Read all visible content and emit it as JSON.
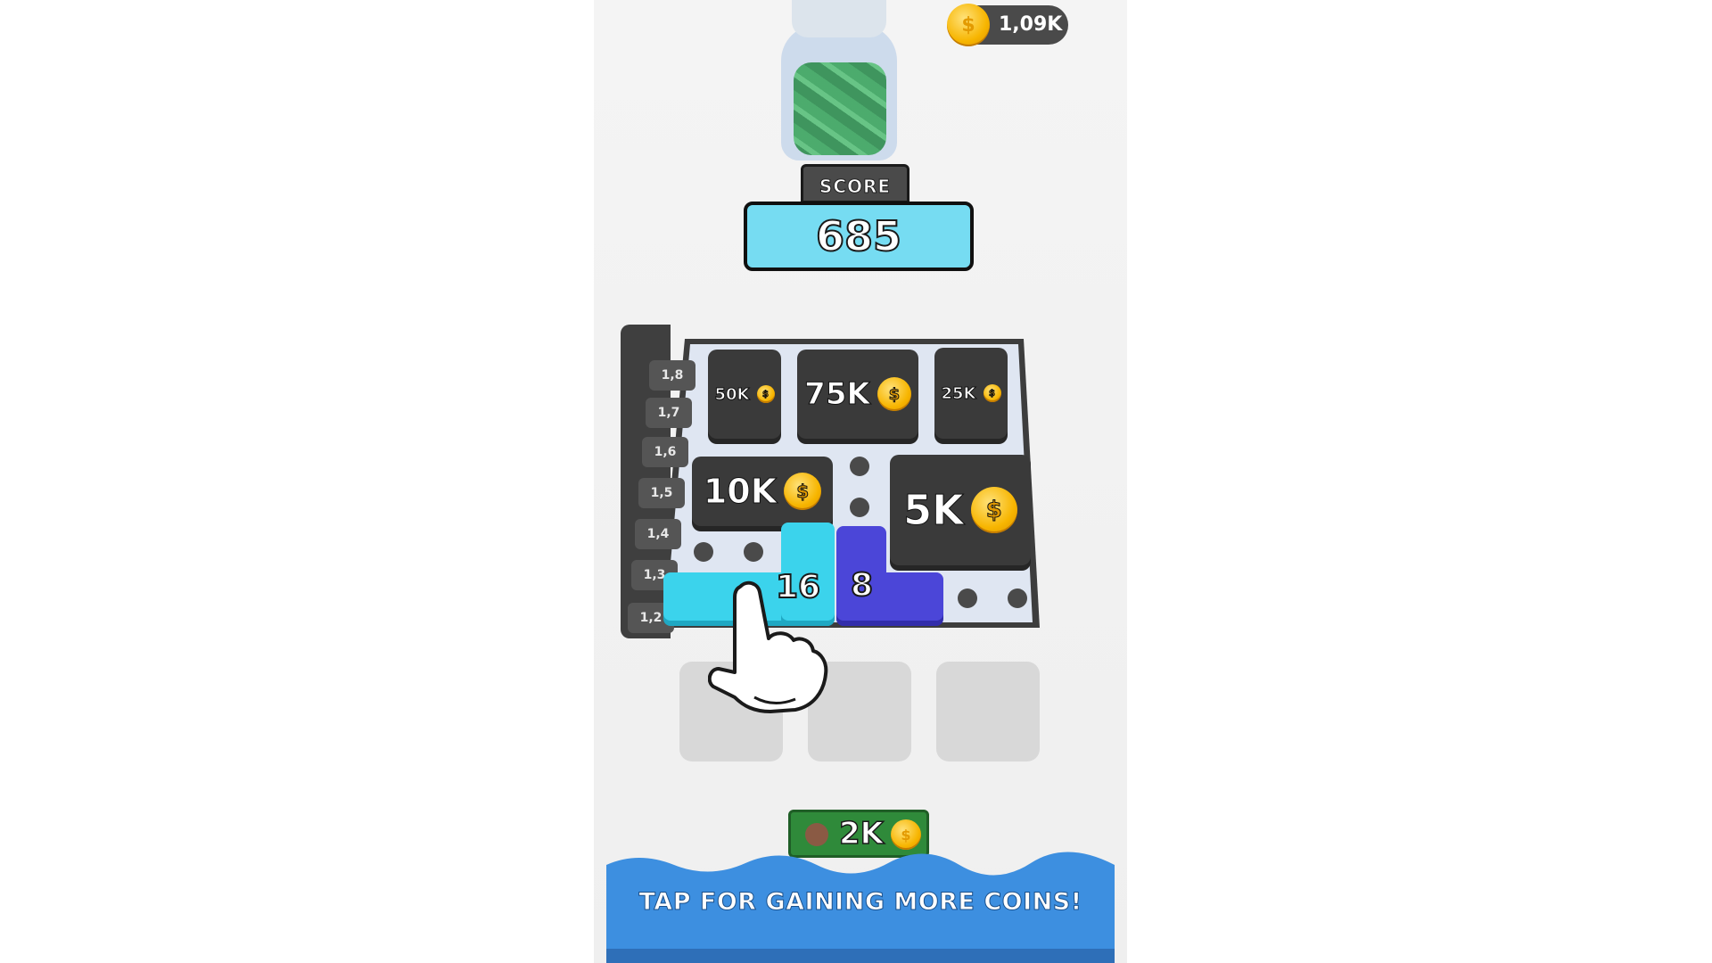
{
  "hud": {
    "coins": "1,09K",
    "coin_icon": "coin-icon"
  },
  "score": {
    "label": "SCORE",
    "value": "685"
  },
  "board": {
    "multipliers": [
      "1,2",
      "1,3",
      "1,4",
      "1,5",
      "1,6",
      "1,7",
      "1,8"
    ],
    "reward_tiles": [
      {
        "value": "50K"
      },
      {
        "value": "75K"
      },
      {
        "value": "25K"
      },
      {
        "value": "10K"
      },
      {
        "value": "5K"
      }
    ],
    "blocks": [
      {
        "value": "16",
        "color": "#3bd3ec"
      },
      {
        "value": "8",
        "color": "#4b46d8"
      }
    ]
  },
  "shop": {
    "price": "2K"
  },
  "banner": {
    "text": "TAP FOR GAINING MORE COINS!",
    "color": "#3d8fe0"
  },
  "colors": {
    "tile": "#3a3a3a",
    "board": "#dfe6f2",
    "coin": "#f7b500"
  }
}
